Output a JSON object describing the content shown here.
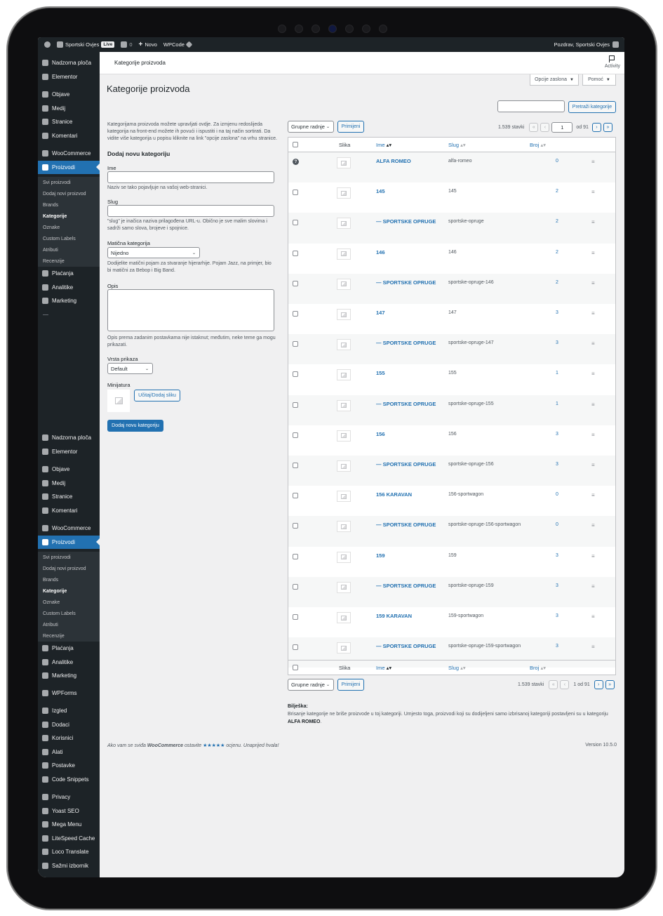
{
  "adminbar": {
    "site": "Sportski Ovjes",
    "live": "Live",
    "comments": "0",
    "new": "Novo",
    "wpcode": "WPCode",
    "greeting": "Pozdrav, Sportski Ovjes"
  },
  "sidebar": {
    "top": [
      {
        "label": "Nadzorna ploča",
        "icon": "dashboard-icon"
      },
      {
        "label": "Elementor",
        "icon": "elementor-icon"
      },
      {
        "label": "Objave",
        "icon": "pin-icon"
      },
      {
        "label": "Medij",
        "icon": "media-icon"
      },
      {
        "label": "Stranice",
        "icon": "pages-icon"
      },
      {
        "label": "Komentari",
        "icon": "comment-icon"
      },
      {
        "label": "WooCommerce",
        "icon": "woocommerce-icon"
      },
      {
        "label": "Proizvodi",
        "icon": "products-icon"
      }
    ],
    "sub": [
      "Svi proizvodi",
      "Dodaj novi proizvod",
      "Brands",
      "Kategorije",
      "Oznake",
      "Custom Labels",
      "Atributi",
      "Recenzije"
    ],
    "after": [
      {
        "label": "Plaćanja",
        "icon": "payments-icon"
      },
      {
        "label": "Analitike",
        "icon": "analytics-icon"
      },
      {
        "label": "Marketing",
        "icon": "megaphone-icon"
      }
    ],
    "bottom": [
      {
        "label": "WPForms",
        "icon": "wpforms-icon"
      },
      {
        "label": "Izgled",
        "icon": "brush-icon"
      },
      {
        "label": "Dodaci",
        "icon": "plugin-icon"
      },
      {
        "label": "Korisnici",
        "icon": "users-icon"
      },
      {
        "label": "Alati",
        "icon": "wrench-icon"
      },
      {
        "label": "Postavke",
        "icon": "settings-icon"
      },
      {
        "label": "Code Snippets",
        "icon": "code-icon"
      },
      {
        "label": "Privacy",
        "icon": "privacy-icon"
      },
      {
        "label": "Yoast SEO",
        "icon": "yoast-icon"
      },
      {
        "label": "Mega Menu",
        "icon": "megamenu-icon"
      },
      {
        "label": "LiteSpeed Cache",
        "icon": "litespeed-icon"
      },
      {
        "label": "Loco Translate",
        "icon": "translate-icon"
      },
      {
        "label": "Sažmi izbornik",
        "icon": "collapse-icon"
      }
    ]
  },
  "header": {
    "strip_title": "Kategorije proizvoda",
    "activity": "Activity",
    "screen_options": "Opcije zaslona",
    "help": "Pomoć",
    "page_title": "Kategorije proizvoda",
    "search_button": "Pretraži kategorije"
  },
  "form": {
    "intro": "Kategorijama proizvoda možete upravljati ovdje. Za izmjenu redoslijeda kategorija na front-end možete ih povući i ispustiti i na taj način sortirati. Da vidite više kategorija u popisu kliknite na link \"opcije zaslona\" na vrhu stranice.",
    "heading": "Dodaj novu kategoriju",
    "name_label": "Ime",
    "name_help": "Naziv se tako pojavljuje na vašoj web-stranici.",
    "slug_label": "Slug",
    "slug_help": "\"slug\" je inačica naziva prilagođena URL-u. Obično je sve malim slovima i sadrži samo slova, brojeve i spojnice.",
    "parent_label": "Matična kategorija",
    "parent_value": "Nijedno",
    "parent_help": "Dodijelite matični pojam za stvaranje hijerarhije. Pojam Jazz, na primjer, bio bi matični za Bebop i Big Band.",
    "desc_label": "Opis",
    "desc_help": "Opis prema zadanim postavkama nije istaknut; međutim, neke teme ga mogu prikazati.",
    "display_label": "Vrsta prikaza",
    "display_value": "Default",
    "thumb_label": "Minijatura",
    "upload_button": "Učitaj/Dodaj sliku",
    "submit_button": "Dodaj novu kategoriju"
  },
  "list": {
    "bulk_label": "Grupne radnje",
    "apply": "Primijeni",
    "count": "1.539 stavki",
    "page_current": "1",
    "page_total": "od 91",
    "page_text_bottom": "1 od 91",
    "columns": {
      "image": "Slika",
      "name": "Ime",
      "slug": "Slug",
      "count": "Broj"
    },
    "rows": [
      {
        "name": "ALFA ROMEO",
        "slug": "alfa-romeo",
        "count": "0",
        "default": true
      },
      {
        "name": "145",
        "slug": "145",
        "count": "2"
      },
      {
        "name": "— SPORTSKE OPRUGE",
        "slug": "sportske-opruge",
        "count": "2"
      },
      {
        "name": "146",
        "slug": "146",
        "count": "2"
      },
      {
        "name": "— SPORTSKE OPRUGE",
        "slug": "sportske-opruge-146",
        "count": "2"
      },
      {
        "name": "147",
        "slug": "147",
        "count": "3"
      },
      {
        "name": "— SPORTSKE OPRUGE",
        "slug": "sportske-opruge-147",
        "count": "3"
      },
      {
        "name": "155",
        "slug": "155",
        "count": "1"
      },
      {
        "name": "— SPORTSKE OPRUGE",
        "slug": "sportske-opruge-155",
        "count": "1"
      },
      {
        "name": "156",
        "slug": "156",
        "count": "3"
      },
      {
        "name": "— SPORTSKE OPRUGE",
        "slug": "sportske-opruge-156",
        "count": "3"
      },
      {
        "name": "156 KARAVAN",
        "slug": "156-sportwagon",
        "count": "0"
      },
      {
        "name": "— SPORTSKE OPRUGE",
        "slug": "sportske-opruge-156-sportwagon",
        "count": "0"
      },
      {
        "name": "159",
        "slug": "159",
        "count": "3"
      },
      {
        "name": "— SPORTSKE OPRUGE",
        "slug": "sportske-opruge-159",
        "count": "3"
      },
      {
        "name": "159 KARAVAN",
        "slug": "159-sportwagon",
        "count": "3"
      },
      {
        "name": "— SPORTSKE OPRUGE",
        "slug": "sportske-opruge-159-sportwagon",
        "count": "3"
      }
    ]
  },
  "note": {
    "title": "Bilješka:",
    "text": "Brisanje kategorije ne briše proizvode u toj kategoriji. Umjesto toga, proizvodi koji su dodijeljeni samo izbrisanoj kategoriji postavljeni su u kategoriju",
    "category": "ALFA ROMEO",
    "end": "."
  },
  "footer": {
    "text_before": "Ako vam se sviđa",
    "brand": "WooCommerce",
    "text_mid": "ostavite",
    "stars": "★★★★★",
    "text_after": "ocjenu. Unaprijed hvala!",
    "version": "Version 10.5.0"
  },
  "colors": {
    "accent": "#2271b1",
    "adminbar": "#1d2327",
    "menu_active": "#2271b1"
  }
}
